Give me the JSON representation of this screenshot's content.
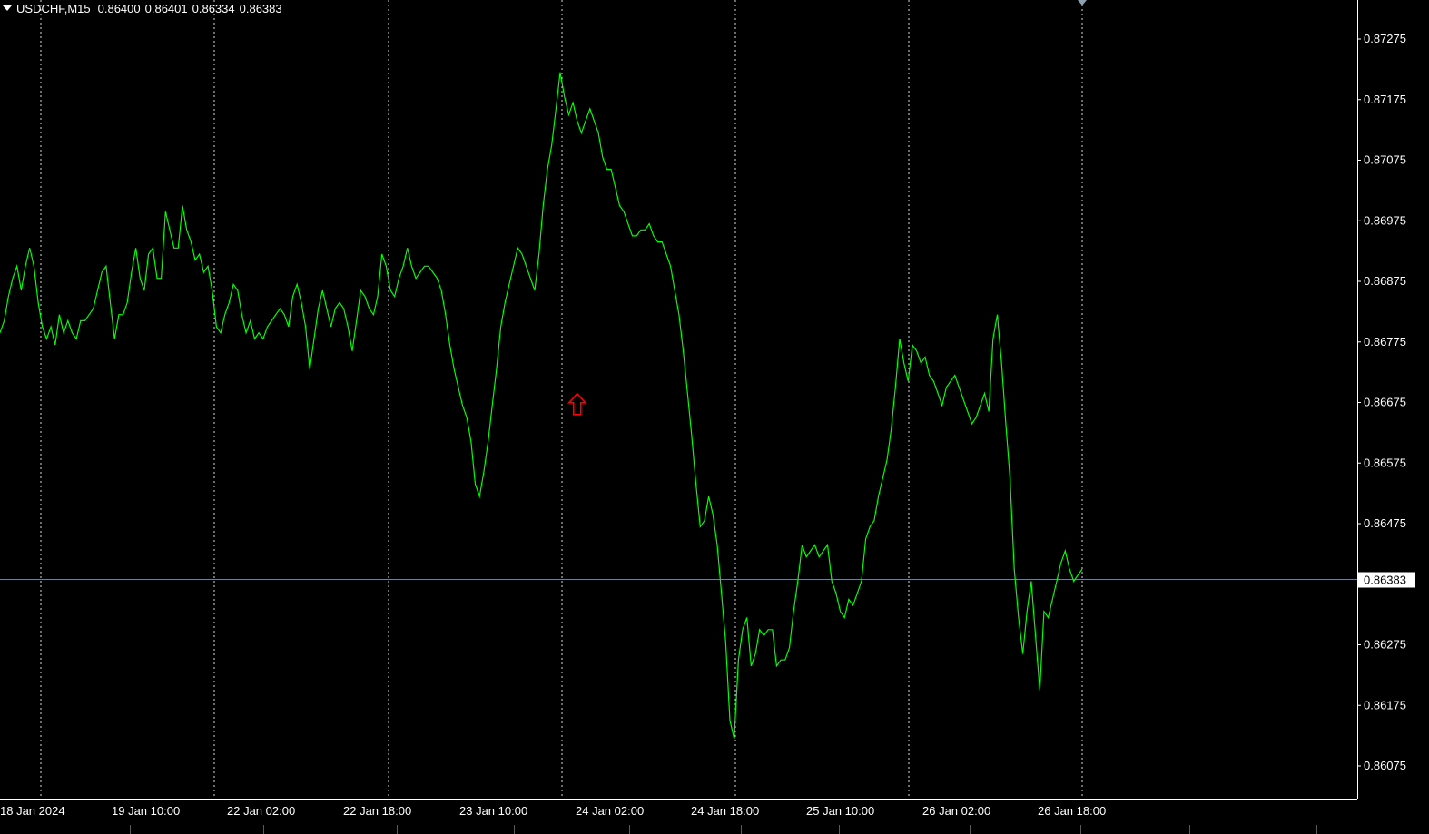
{
  "window": {
    "symbol": "USDCHF,M15",
    "quotes": [
      "0.86400",
      "0.86401",
      "0.86334",
      "0.86383"
    ],
    "header_icon": "dropdown-triangle-icon",
    "colors": {
      "background": "#000000",
      "series": "#00ff00",
      "grid": "#ffffff",
      "axis_text": "#ffffff",
      "bid_line": "#708090",
      "arrow": "#ff0000",
      "price_tag_bg": "#ffffff",
      "price_tag_text": "#000000"
    }
  },
  "chart_data": {
    "type": "line",
    "series": [
      {
        "values": [
          0.8679,
          0.8681,
          0.8685,
          0.8688,
          0.869,
          0.8686,
          0.869,
          0.8693,
          0.869,
          0.8684,
          0.868,
          0.8678,
          0.868,
          0.8677,
          0.8682,
          0.8679,
          0.8681,
          0.8679,
          0.8678,
          0.8681,
          0.8681,
          0.8682,
          0.8683,
          0.8686,
          0.8689,
          0.869,
          0.8684,
          0.8678,
          0.8682,
          0.8682,
          0.8684,
          0.8689,
          0.8693,
          0.8688,
          0.8686,
          0.8692,
          0.8693,
          0.8688,
          0.8688,
          0.8699,
          0.8696,
          0.8693,
          0.8693,
          0.87,
          0.8696,
          0.8694,
          0.8691,
          0.8692,
          0.8689,
          0.869,
          0.8686,
          0.868,
          0.8679,
          0.8682,
          0.8684,
          0.8687,
          0.8686,
          0.8682,
          0.8679,
          0.8681,
          0.8678,
          0.8679,
          0.8678,
          0.868,
          0.8681,
          0.8682,
          0.8683,
          0.8682,
          0.868,
          0.8685,
          0.8687,
          0.8684,
          0.868,
          0.8673,
          0.8678,
          0.8683,
          0.8686,
          0.8683,
          0.868,
          0.8683,
          0.8684,
          0.8683,
          0.868,
          0.8676,
          0.8681,
          0.8686,
          0.8685,
          0.8683,
          0.8682,
          0.8685,
          0.8692,
          0.869,
          0.8686,
          0.8685,
          0.8688,
          0.869,
          0.8693,
          0.869,
          0.8688,
          0.8689,
          0.869,
          0.869,
          0.8689,
          0.8688,
          0.8686,
          0.8682,
          0.8677,
          0.8673,
          0.867,
          0.8667,
          0.8665,
          0.8661,
          0.8654,
          0.8652,
          0.8656,
          0.8661,
          0.8667,
          0.8673,
          0.868,
          0.8684,
          0.8687,
          0.869,
          0.8693,
          0.8692,
          0.869,
          0.8688,
          0.8686,
          0.8692,
          0.87,
          0.8706,
          0.871,
          0.8716,
          0.8722,
          0.8718,
          0.8715,
          0.8717,
          0.8714,
          0.8712,
          0.8714,
          0.8716,
          0.8714,
          0.8712,
          0.8708,
          0.8706,
          0.8706,
          0.8703,
          0.87,
          0.8699,
          0.8697,
          0.8695,
          0.8695,
          0.8696,
          0.8696,
          0.8697,
          0.8695,
          0.8694,
          0.8694,
          0.8692,
          0.869,
          0.8686,
          0.8682,
          0.8676,
          0.8669,
          0.8662,
          0.8654,
          0.8647,
          0.8648,
          0.8652,
          0.8649,
          0.8644,
          0.8636,
          0.8628,
          0.8615,
          0.8612,
          0.8625,
          0.863,
          0.8632,
          0.8624,
          0.8626,
          0.863,
          0.8629,
          0.863,
          0.863,
          0.8624,
          0.8625,
          0.8625,
          0.8627,
          0.8633,
          0.8638,
          0.8644,
          0.8642,
          0.8643,
          0.8644,
          0.8642,
          0.8643,
          0.8644,
          0.8638,
          0.8636,
          0.8633,
          0.8632,
          0.8635,
          0.8634,
          0.8636,
          0.8638,
          0.8645,
          0.8647,
          0.8648,
          0.8652,
          0.8655,
          0.8658,
          0.8663,
          0.867,
          0.8678,
          0.8674,
          0.8671,
          0.8677,
          0.8676,
          0.8674,
          0.8675,
          0.8672,
          0.8671,
          0.8669,
          0.8667,
          0.867,
          0.8671,
          0.8672,
          0.867,
          0.8668,
          0.8666,
          0.8664,
          0.8665,
          0.8667,
          0.8669,
          0.8666,
          0.8678,
          0.8682,
          0.8674,
          0.8664,
          0.8655,
          0.864,
          0.8632,
          0.8626,
          0.8633,
          0.8638,
          0.8629,
          0.862,
          0.8633,
          0.8632,
          0.8635,
          0.8638,
          0.8641,
          0.8643,
          0.864,
          0.8638,
          0.8639,
          0.864
        ]
      }
    ],
    "x_ticks": [
      "18 Jan 2024",
      "19 Jan 10:00",
      "22 Jan 02:00",
      "22 Jan 18:00",
      "23 Jan 10:00",
      "24 Jan 02:00",
      "24 Jan 18:00",
      "25 Jan 10:00",
      "26 Jan 02:00",
      "26 Jan 18:00"
    ],
    "y_ticks": [
      "0.87275",
      "0.87175",
      "0.87075",
      "0.86975",
      "0.86875",
      "0.86775",
      "0.86675",
      "0.86575",
      "0.86475",
      "0.86383",
      "0.86275",
      "0.86175",
      "0.86075"
    ],
    "y_tick_values": [
      0.87275,
      0.87175,
      0.87075,
      0.86975,
      0.86875,
      0.86775,
      0.86675,
      0.86575,
      0.86475,
      0.86383,
      0.86275,
      0.86175,
      0.86075
    ],
    "ylim": [
      0.86025,
      0.87325
    ],
    "current_price": 0.86383,
    "current_price_label": "0.86383",
    "grid": "vertical dotted",
    "annotations": [
      {
        "type": "up-arrow",
        "x_index": 136,
        "value": 0.8667
      }
    ]
  }
}
